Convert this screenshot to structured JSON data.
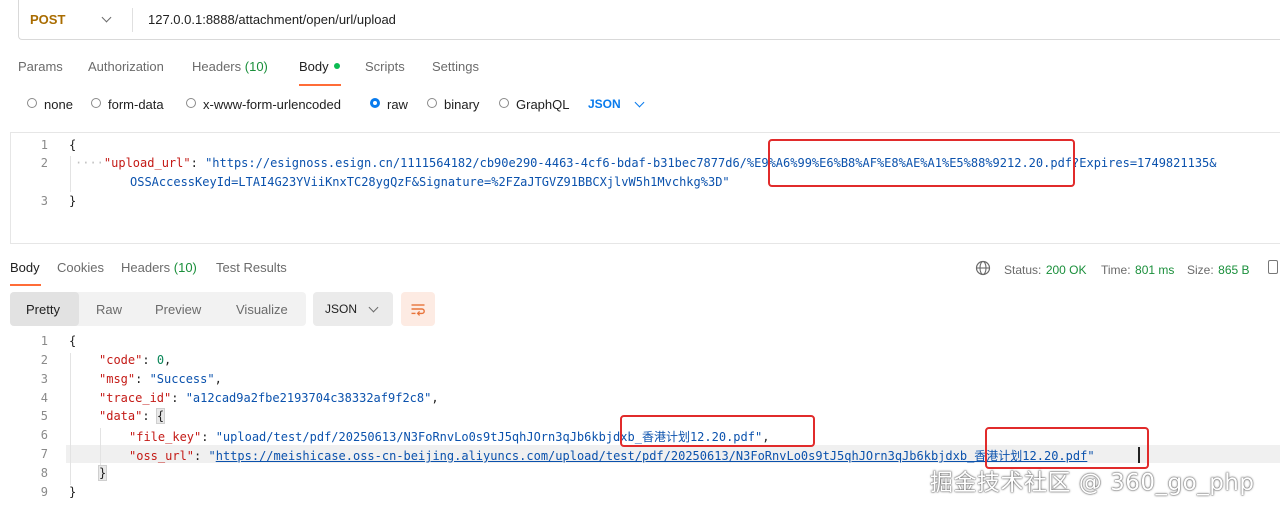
{
  "request": {
    "method": "POST",
    "url": "127.0.0.1:8888/attachment/open/url/upload"
  },
  "request_tabs": [
    {
      "label": "Params"
    },
    {
      "label": "Authorization"
    },
    {
      "label": "Headers",
      "count": "(10)"
    },
    {
      "label": "Body"
    },
    {
      "label": "Scripts"
    },
    {
      "label": "Settings"
    }
  ],
  "body_types": [
    "none",
    "form-data",
    "x-www-form-urlencoded",
    "raw",
    "binary",
    "GraphQL"
  ],
  "body_type_selected": "raw",
  "body_format": "JSON",
  "request_body": {
    "line_numbers": [
      "1",
      "2",
      "3"
    ],
    "open_brace": "{",
    "close_brace": "}",
    "key": "\"upload_url\"",
    "colon": ": ",
    "value_part1": "\"https://esignoss.esign.cn/1111564182/cb90e290-4463-4cf6-bdaf-b31bec7877d6/%E9%A6%99%E6%B8%AF%E8%AE%A1%E5%88%9212.20.pdf?Expires=1749821135&",
    "value_part2": "OSSAccessKeyId=LTAI4G23YViiKnxTC28ygQzF&Signature=%2FZaJTGVZ91BBCXjlvW5h1Mvchkg%3D\""
  },
  "response_tabs": [
    {
      "label": "Body"
    },
    {
      "label": "Cookies"
    },
    {
      "label": "Headers",
      "count": "(10)"
    },
    {
      "label": "Test Results"
    }
  ],
  "response_status": {
    "status_label": "Status:",
    "status_value": "200 OK",
    "time_label": "Time:",
    "time_value": "801 ms",
    "size_label": "Size:",
    "size_value": "865 B"
  },
  "view_modes": [
    "Pretty",
    "Raw",
    "Preview",
    "Visualize"
  ],
  "view_mode_selected": "Pretty",
  "response_format": "JSON",
  "response_body": {
    "line_numbers": [
      "1",
      "2",
      "3",
      "4",
      "5",
      "6",
      "7",
      "8",
      "9"
    ],
    "open_brace": "{",
    "close_brace": "}",
    "code_key": "\"code\"",
    "code_val": "0",
    "msg_key": "\"msg\"",
    "msg_val": "\"Success\"",
    "trace_key": "\"trace_id\"",
    "trace_val": "\"a12cad9a2fbe2193704c38332af9f2c8\"",
    "data_key": "\"data\"",
    "data_open": "{",
    "data_close": "}",
    "file_key_key": "\"file_key\"",
    "file_key_val": "\"upload/test/pdf/20250613/N3FoRnvLo0s9tJ5qhJOrn3qJb6kbjdxb_香港计划12.20.pdf\"",
    "oss_url_key": "\"oss_url\"",
    "oss_url_q": "\"",
    "oss_url_val": "https://meishicase.oss-cn-beijing.aliyuncs.com/upload/test/pdf/20250613/N3FoRnvLo0s9tJ5qhJOrn3qJb6kbjdxb_香港计划12.20.pdf"
  },
  "watermark": "掘金技术社区 @ 360_go_php",
  "colors": {
    "method": "#a96c00",
    "accent": "#ff6c37",
    "link": "#097bed",
    "json_key": "#c41a16",
    "json_string": "#0b52ad",
    "status_ok": "#1a8f3b",
    "annotation": "#e12b2b"
  }
}
